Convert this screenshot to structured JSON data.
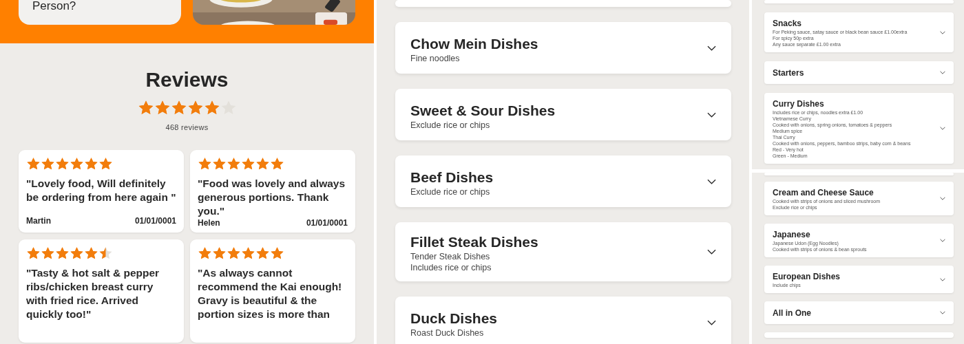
{
  "hero": {
    "card_text": "Person?"
  },
  "reviews": {
    "title": "Reviews",
    "stars": 5,
    "count": "468 reviews",
    "items": [
      {
        "stars": 6,
        "text": "\"Lovely food, Will definitely be ordering from here again \"",
        "author": "Martin",
        "date": "01/01/0001"
      },
      {
        "stars": 6,
        "text": "\"Food was lovely and always generous portions. Thank you.\"",
        "author": "Helen",
        "date": "01/01/0001"
      },
      {
        "stars": 5.5,
        "text": "\"Tasty & hot salt & pepper ribs/chicken breast curry with fried rice. Arrived quickly too!\""
      },
      {
        "stars": 6,
        "text": "\"As always cannot recommend the Kai enough! Gravy is beautiful & the portion sizes is more than"
      }
    ]
  },
  "menu": {
    "categories": [
      {
        "name": "Chow Mein Dishes",
        "notes": [
          "Fine noodles"
        ]
      },
      {
        "name": "Sweet & Sour Dishes",
        "notes": [
          "Exclude rice or chips"
        ]
      },
      {
        "name": "Beef Dishes",
        "notes": [
          "Exclude rice or chips"
        ]
      },
      {
        "name": "Fillet Steak Dishes",
        "notes": [
          "Tender Steak Dishes",
          "Includes rice or chips"
        ]
      },
      {
        "name": "Duck Dishes",
        "notes": [
          "Roast Duck Dishes"
        ]
      }
    ]
  },
  "menu_compact_top": {
    "categories": [
      {
        "name": "Snacks",
        "notes": [
          "For Peking sauce, satay sauce or black bean sauce £1.00extra",
          "For spicy 50p extra",
          "Any sauce separate £1.00 extra"
        ]
      },
      {
        "name": "Starters"
      },
      {
        "name": "Curry Dishes",
        "notes": [
          "Includes rice or chips, noodles extra £1.00",
          "Vietnamese Curry",
          "Cooked with onions, spring onions, tomatoes & peppers",
          "Medium spice",
          "Thai Curry",
          "Cooked with onions, peppers, bamboo strips, baby corn & beans",
          "Red - Very hot",
          "Green - Medium"
        ]
      }
    ]
  },
  "menu_compact_bottom": {
    "categories": [
      {
        "name": "Cream and Cheese Sauce",
        "notes": [
          "Cooked with strips of onions and sliced mushroom",
          "Exclude rice or chips"
        ]
      },
      {
        "name": "Japanese",
        "notes": [
          "Japanese Udon (Egg Noodles)",
          "Cooked with strips of onions & bean sprouts"
        ]
      },
      {
        "name": "European Dishes",
        "notes": [
          "Include chips"
        ]
      },
      {
        "name": "All in One"
      }
    ]
  }
}
